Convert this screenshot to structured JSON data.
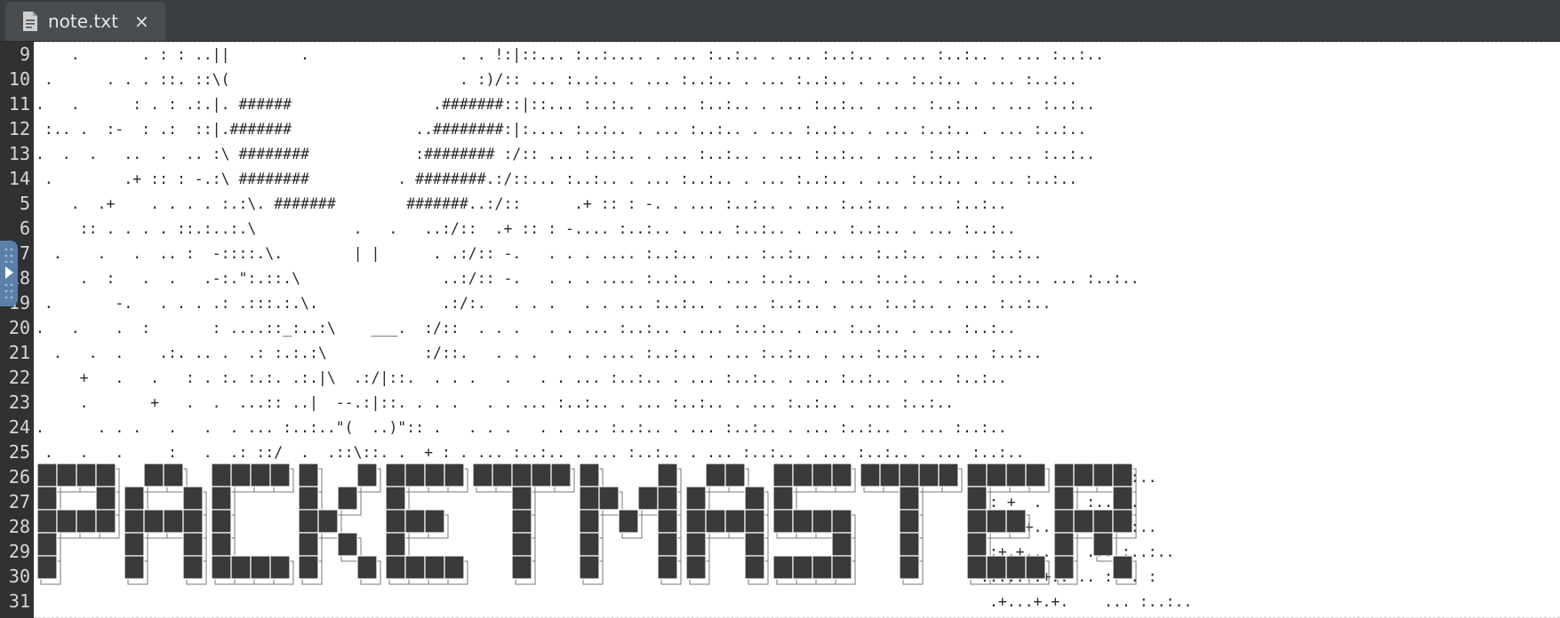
{
  "tab": {
    "title": "note.txt",
    "close_glyph": "×",
    "icon": "text-file-icon"
  },
  "colors": {
    "tabbar": "#3b3e40",
    "tab": "#4a4d50",
    "gutter": "#2f3133",
    "banner": "#3a3a3a",
    "handle": "#5b7fa8"
  },
  "line_numbers": [
    "9",
    "10",
    "11",
    "12",
    "13",
    "14",
    "5",
    "6",
    "7",
    "18",
    "19",
    "20",
    "21",
    "22",
    "23",
    "24",
    "25",
    "26",
    "27",
    "28",
    "29",
    "30",
    "31"
  ],
  "lines": [
    "    .       . : : ..||        .                 . . !:|::... :..:.... . ... :..:.. . ... :..:.. . ... :..:.. . ... :..:..",
    " .      . . . ::. ::\\(                          . :)/:: ... :..:.. . ... :..:.. . ... :..:.. . ... :..:.. . ... :..:..",
    ".   .      : . : .:.|. ######                .#######::|::... :..:.. . ... :..:.. . ... :..:.. . ... :..:.. . ... :..:..",
    " :.. .  :-  : .:  ::|.#######              ..########:|:.... :..:.. . ... :..:.. . ... :..:.. . ... :..:.. . ... :..:..",
    ".  .  .   ..  .  .. :\\ ########            :######## :/:: ... :..:.. . ... :..:.. . ... :..:.. . ... :..:.. . ... :..:..",
    " .        .+ :: : -.:\\ ########          . ########.:/::... :..:.. . ... :..:.. . ... :..:.. . ... :..:.. . ... :..:..",
    "    .  .+    . . . . :.:\\. #######        #######..:/::      .+ :: : -. . ... :..:.. . ... :..:.. . ... :..:..",
    "     :: . . . . ::.:..:.\\           .   .   ..:/::  .+ :: : -.... :..:.. . ... :..:.. . ... :..:.. . ... :..:..",
    "  .    .   .  .. :  -::::.\\.        | |      . .:/:: -.   . . . .... :..:.. . ... :..:.. . ... :..:.. . ... :..:..",
    "     .  :   .  .   .-:.\":.::.\\                ..:/:: -.   . . . .... :..:.. . ... :..:.. . ... :..:.. . ... :..:.. ... :..:..",
    " .       -.   . . . .: .:::.:.\\.              .:/:.   . . .   . . ... :..:.. . ... :..:.. . ... :..:.. . ... :..:..",
    ".   .    .  :       : ....::_:..:\\    ___.  :/::  . . .   . . ... :..:.. . ... :..:.. . ... :..:.. . ... :..:..",
    "  .   .  .    .:. .. .  .: :.:.:\\           :/::.   . . .   . . .... :..:.. . ... :..:.. . ... :..:.. . ... :..:..",
    "     +   .   .   : . :. :.:. .:.|\\  .:/|::.  . . .   .   . . ... :..:.. . ... :..:.. . ... :..:.. . ... :..:..",
    "     .       +   .  .  ...:: ..|  --.:|::. . . .   . . ... :..:.. . ... :..:.. . ... :..:.. . ... :..:..",
    ".      . . .   .   .  . ... :..:..\"(  ..)\":: .   . . .   . . ... :..:.. . ... :..:.. . ... :..:.. . ... :..:..",
    " .   .   .     :   .  .: ::/  .  .::\\::. .  + : . ... :..:.. . ... :..:.. . ... :..:.. . ... :..:.. . ... :..:..",
    "                                                                                                            ::.+ : . ... :..:..",
    "                                                                                                           .: +  . ... :..:..",
    "                                                                                                           .:...+..  ... :..:..",
    "                                                                                                           .:+.+...: . ... :..:..",
    "                                                                                                           ...::+.+.. .. :  . :",
    "                                                                                                            .+...+.+.    ... :..:.."
  ],
  "banner_text": "PACKETMASTER"
}
